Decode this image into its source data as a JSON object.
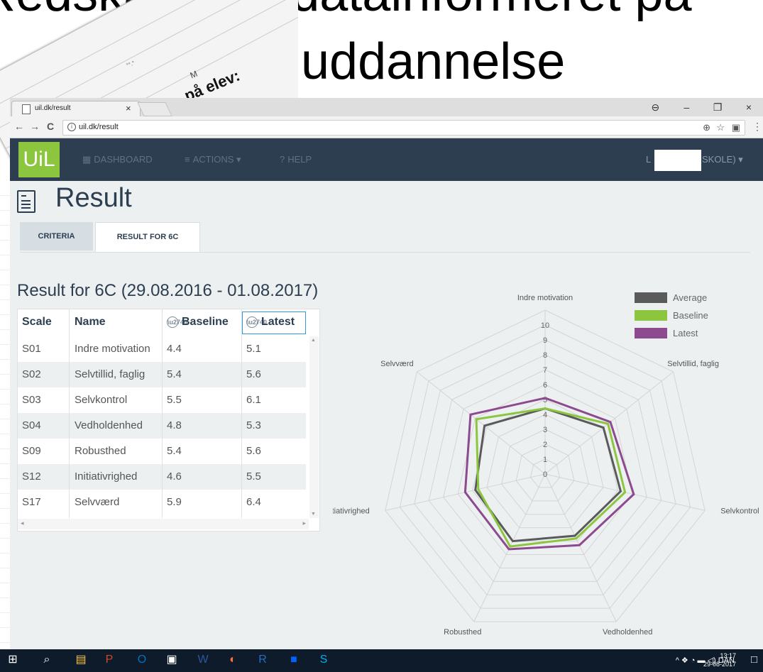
{
  "slide": {
    "title_line_1": "Redskaber til datainformeret på",
    "title_line_2": "uddannelse",
    "bg_text_main": "på elev:",
    "bg_text_small": "M",
    "bg_text_tiny": "°°.°"
  },
  "browser": {
    "tab_title": "uil.dk/result",
    "tab_close": "×",
    "url": "uil.dk/result",
    "window_controls": [
      "⊖",
      "–",
      "❐",
      "×"
    ],
    "nav": {
      "back": "←",
      "forward": "→",
      "reload": "C"
    },
    "omni_icons": [
      "⊕",
      "☆",
      "▣",
      "⋮"
    ]
  },
  "navbar": {
    "brand": "UiL",
    "items": [
      {
        "icon": "▦",
        "label": "DASHBOARD"
      },
      {
        "icon": "≡",
        "label": "ACTIONS ▾"
      },
      {
        "icon": "?",
        "label": "HELP"
      }
    ],
    "user_prefix": "L",
    "user_suffix": "SKOLE) ▾"
  },
  "page": {
    "title": "Result",
    "tabs": [
      "CRITERIA",
      "RESULT FOR 6C"
    ],
    "subtitle": "Result for 6C (29.08.2016 - 01.08.2017)"
  },
  "table": {
    "columns": [
      "Scale",
      "Name",
      "Baseline",
      "Latest"
    ],
    "rows": [
      {
        "scale": "S01",
        "name": "Indre motivation",
        "baseline": "4.4",
        "latest": "5.1"
      },
      {
        "scale": "S02",
        "name": "Selvtillid, faglig",
        "baseline": "5.4",
        "latest": "5.6"
      },
      {
        "scale": "S03",
        "name": "Selvkontrol",
        "baseline": "5.5",
        "latest": "6.1"
      },
      {
        "scale": "S04",
        "name": "Vedholdenhed",
        "baseline": "4.8",
        "latest": "5.3"
      },
      {
        "scale": "S09",
        "name": "Robusthed",
        "baseline": "5.4",
        "latest": "5.6"
      },
      {
        "scale": "S12",
        "name": "Initiativrighed",
        "baseline": "4.6",
        "latest": "5.5"
      },
      {
        "scale": "S17",
        "name": "Selvværd",
        "baseline": "5.9",
        "latest": "6.4"
      }
    ],
    "scroll_up": "▲",
    "scroll_down": "▼",
    "scroll_left": "◂",
    "scroll_right": "▸"
  },
  "chart_data": {
    "type": "radar",
    "axes": [
      "Indre motivation",
      "Selvtillid, faglig",
      "Selvkontrol",
      "Vedholdenhed",
      "Robusthed",
      "Initiativrighed",
      "Selvværd"
    ],
    "scale_min": 0,
    "scale_max": 10,
    "ticks": [
      "0",
      "1",
      "2",
      "3",
      "4",
      "5",
      "6",
      "7",
      "8",
      "9",
      "10"
    ],
    "series": [
      {
        "name": "Average",
        "color": "#5a5a5a",
        "values": [
          4.4,
          5.0,
          5.2,
          4.6,
          5.0,
          4.8,
          5.2
        ]
      },
      {
        "name": "Baseline",
        "color": "#8cc63f",
        "values": [
          4.4,
          5.4,
          5.5,
          4.8,
          5.4,
          4.6,
          5.9
        ]
      },
      {
        "name": "Latest",
        "color": "#8e4a8f",
        "values": [
          5.1,
          5.6,
          6.1,
          5.3,
          5.6,
          5.5,
          6.4
        ]
      }
    ],
    "legend_position": "top-right"
  },
  "taskbar": {
    "icons": [
      "⊞",
      "⌕",
      "▤",
      "P",
      "O",
      "▣",
      "W",
      "◐",
      "R",
      "■",
      "S"
    ],
    "tray": "^ ❖ ◔ ▬ ◁) DAN",
    "time": "13:17",
    "date": "29-08-2017",
    "notify": "□"
  }
}
